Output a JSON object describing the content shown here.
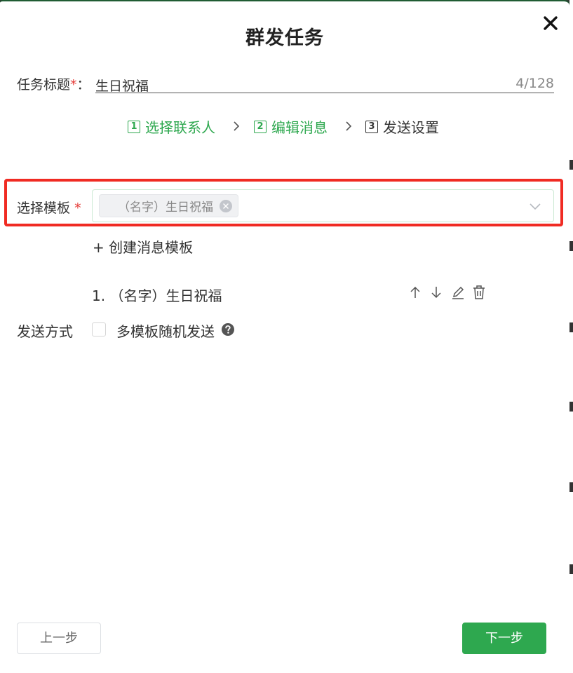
{
  "dialog": {
    "title": "群发任务"
  },
  "task_title": {
    "label": "任务标题",
    "required_mark": "*",
    "colon": "：",
    "value": "生日祝福",
    "count": "4/128"
  },
  "steps": [
    {
      "num": "1",
      "label": "选择联系人",
      "state": "active"
    },
    {
      "num": "2",
      "label": "编辑消息",
      "state": "active"
    },
    {
      "num": "3",
      "label": "发送设置",
      "state": "todo"
    }
  ],
  "template_select": {
    "label": "选择模板",
    "required_mark": "*",
    "selected_tag": "（名字）生日祝福"
  },
  "create_template_link": "+ 创建消息模板",
  "template_list": [
    {
      "index": "1.",
      "name": "（名字）生日祝福"
    }
  ],
  "send_mode": {
    "label": "发送方式",
    "checkbox_label": "多模板随机发送",
    "checked": false
  },
  "footer": {
    "prev_label": "上一步",
    "next_label": "下一步"
  },
  "colors": {
    "accent": "#2ea84f",
    "highlight": "#f02b23",
    "required": "#e53935"
  }
}
